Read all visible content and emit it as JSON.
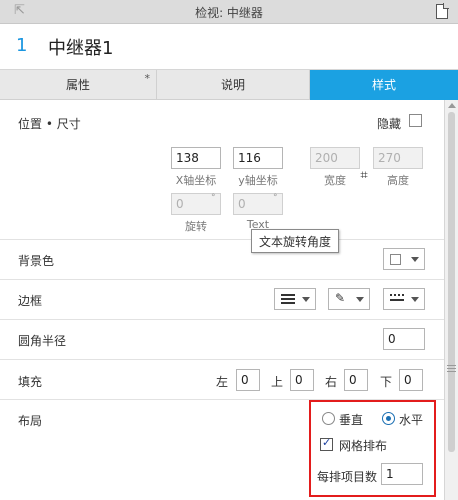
{
  "window": {
    "title": "检视: 中继器"
  },
  "header": {
    "number": "1",
    "name": "中继器1"
  },
  "tabs": [
    {
      "label": "属性",
      "modified_marker": "*"
    },
    {
      "label": "说明"
    },
    {
      "label": "样式",
      "active": true
    }
  ],
  "position_size": {
    "label": "位置 • 尺寸",
    "hide_label": "隐藏",
    "x": {
      "value": "138",
      "caption": "X轴坐标"
    },
    "y": {
      "value": "116",
      "caption": "y轴坐标"
    },
    "width": {
      "value": "200",
      "caption": "宽度"
    },
    "height": {
      "value": "270",
      "caption": "高度"
    },
    "rotation": {
      "value": "0",
      "caption": "旋转",
      "unit": "°"
    },
    "text_rotation": {
      "value": "0",
      "caption": "Text",
      "unit": "°"
    }
  },
  "tooltip": {
    "text": "文本旋转角度"
  },
  "background": {
    "label": "背景色"
  },
  "border": {
    "label": "边框"
  },
  "corner_radius": {
    "label": "圆角半径",
    "value": "0"
  },
  "padding": {
    "label": "填充",
    "left_label": "左",
    "left": "0",
    "top_label": "上",
    "top": "0",
    "right_label": "右",
    "right": "0",
    "bottom_label": "下",
    "bottom": "0"
  },
  "layout": {
    "label": "布局",
    "vertical_label": "垂直",
    "horizontal_label": "水平",
    "selected": "水平",
    "grid_label": "网格排布",
    "grid_checked": true,
    "items_per_row_label": "每排项目数",
    "items_per_row": "1"
  },
  "colors": {
    "accent": "#1ba1e2",
    "highlight_box": "#e31c1c"
  }
}
